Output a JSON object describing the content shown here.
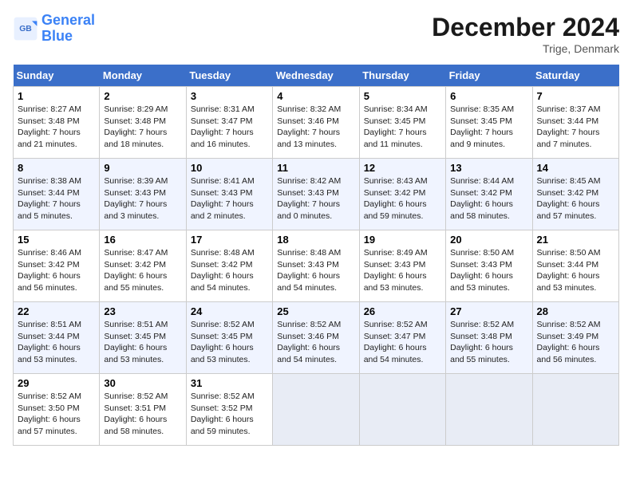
{
  "header": {
    "logo_line1": "General",
    "logo_line2": "Blue",
    "month": "December 2024",
    "location": "Trige, Denmark"
  },
  "days_of_week": [
    "Sunday",
    "Monday",
    "Tuesday",
    "Wednesday",
    "Thursday",
    "Friday",
    "Saturday"
  ],
  "weeks": [
    [
      {
        "day": 1,
        "sunrise": "Sunrise: 8:27 AM",
        "sunset": "Sunset: 3:48 PM",
        "daylight": "Daylight: 7 hours and 21 minutes."
      },
      {
        "day": 2,
        "sunrise": "Sunrise: 8:29 AM",
        "sunset": "Sunset: 3:48 PM",
        "daylight": "Daylight: 7 hours and 18 minutes."
      },
      {
        "day": 3,
        "sunrise": "Sunrise: 8:31 AM",
        "sunset": "Sunset: 3:47 PM",
        "daylight": "Daylight: 7 hours and 16 minutes."
      },
      {
        "day": 4,
        "sunrise": "Sunrise: 8:32 AM",
        "sunset": "Sunset: 3:46 PM",
        "daylight": "Daylight: 7 hours and 13 minutes."
      },
      {
        "day": 5,
        "sunrise": "Sunrise: 8:34 AM",
        "sunset": "Sunset: 3:45 PM",
        "daylight": "Daylight: 7 hours and 11 minutes."
      },
      {
        "day": 6,
        "sunrise": "Sunrise: 8:35 AM",
        "sunset": "Sunset: 3:45 PM",
        "daylight": "Daylight: 7 hours and 9 minutes."
      },
      {
        "day": 7,
        "sunrise": "Sunrise: 8:37 AM",
        "sunset": "Sunset: 3:44 PM",
        "daylight": "Daylight: 7 hours and 7 minutes."
      }
    ],
    [
      {
        "day": 8,
        "sunrise": "Sunrise: 8:38 AM",
        "sunset": "Sunset: 3:44 PM",
        "daylight": "Daylight: 7 hours and 5 minutes."
      },
      {
        "day": 9,
        "sunrise": "Sunrise: 8:39 AM",
        "sunset": "Sunset: 3:43 PM",
        "daylight": "Daylight: 7 hours and 3 minutes."
      },
      {
        "day": 10,
        "sunrise": "Sunrise: 8:41 AM",
        "sunset": "Sunset: 3:43 PM",
        "daylight": "Daylight: 7 hours and 2 minutes."
      },
      {
        "day": 11,
        "sunrise": "Sunrise: 8:42 AM",
        "sunset": "Sunset: 3:43 PM",
        "daylight": "Daylight: 7 hours and 0 minutes."
      },
      {
        "day": 12,
        "sunrise": "Sunrise: 8:43 AM",
        "sunset": "Sunset: 3:42 PM",
        "daylight": "Daylight: 6 hours and 59 minutes."
      },
      {
        "day": 13,
        "sunrise": "Sunrise: 8:44 AM",
        "sunset": "Sunset: 3:42 PM",
        "daylight": "Daylight: 6 hours and 58 minutes."
      },
      {
        "day": 14,
        "sunrise": "Sunrise: 8:45 AM",
        "sunset": "Sunset: 3:42 PM",
        "daylight": "Daylight: 6 hours and 57 minutes."
      }
    ],
    [
      {
        "day": 15,
        "sunrise": "Sunrise: 8:46 AM",
        "sunset": "Sunset: 3:42 PM",
        "daylight": "Daylight: 6 hours and 56 minutes."
      },
      {
        "day": 16,
        "sunrise": "Sunrise: 8:47 AM",
        "sunset": "Sunset: 3:42 PM",
        "daylight": "Daylight: 6 hours and 55 minutes."
      },
      {
        "day": 17,
        "sunrise": "Sunrise: 8:48 AM",
        "sunset": "Sunset: 3:42 PM",
        "daylight": "Daylight: 6 hours and 54 minutes."
      },
      {
        "day": 18,
        "sunrise": "Sunrise: 8:48 AM",
        "sunset": "Sunset: 3:43 PM",
        "daylight": "Daylight: 6 hours and 54 minutes."
      },
      {
        "day": 19,
        "sunrise": "Sunrise: 8:49 AM",
        "sunset": "Sunset: 3:43 PM",
        "daylight": "Daylight: 6 hours and 53 minutes."
      },
      {
        "day": 20,
        "sunrise": "Sunrise: 8:50 AM",
        "sunset": "Sunset: 3:43 PM",
        "daylight": "Daylight: 6 hours and 53 minutes."
      },
      {
        "day": 21,
        "sunrise": "Sunrise: 8:50 AM",
        "sunset": "Sunset: 3:44 PM",
        "daylight": "Daylight: 6 hours and 53 minutes."
      }
    ],
    [
      {
        "day": 22,
        "sunrise": "Sunrise: 8:51 AM",
        "sunset": "Sunset: 3:44 PM",
        "daylight": "Daylight: 6 hours and 53 minutes."
      },
      {
        "day": 23,
        "sunrise": "Sunrise: 8:51 AM",
        "sunset": "Sunset: 3:45 PM",
        "daylight": "Daylight: 6 hours and 53 minutes."
      },
      {
        "day": 24,
        "sunrise": "Sunrise: 8:52 AM",
        "sunset": "Sunset: 3:45 PM",
        "daylight": "Daylight: 6 hours and 53 minutes."
      },
      {
        "day": 25,
        "sunrise": "Sunrise: 8:52 AM",
        "sunset": "Sunset: 3:46 PM",
        "daylight": "Daylight: 6 hours and 54 minutes."
      },
      {
        "day": 26,
        "sunrise": "Sunrise: 8:52 AM",
        "sunset": "Sunset: 3:47 PM",
        "daylight": "Daylight: 6 hours and 54 minutes."
      },
      {
        "day": 27,
        "sunrise": "Sunrise: 8:52 AM",
        "sunset": "Sunset: 3:48 PM",
        "daylight": "Daylight: 6 hours and 55 minutes."
      },
      {
        "day": 28,
        "sunrise": "Sunrise: 8:52 AM",
        "sunset": "Sunset: 3:49 PM",
        "daylight": "Daylight: 6 hours and 56 minutes."
      }
    ],
    [
      {
        "day": 29,
        "sunrise": "Sunrise: 8:52 AM",
        "sunset": "Sunset: 3:50 PM",
        "daylight": "Daylight: 6 hours and 57 minutes."
      },
      {
        "day": 30,
        "sunrise": "Sunrise: 8:52 AM",
        "sunset": "Sunset: 3:51 PM",
        "daylight": "Daylight: 6 hours and 58 minutes."
      },
      {
        "day": 31,
        "sunrise": "Sunrise: 8:52 AM",
        "sunset": "Sunset: 3:52 PM",
        "daylight": "Daylight: 6 hours and 59 minutes."
      },
      null,
      null,
      null,
      null
    ]
  ]
}
